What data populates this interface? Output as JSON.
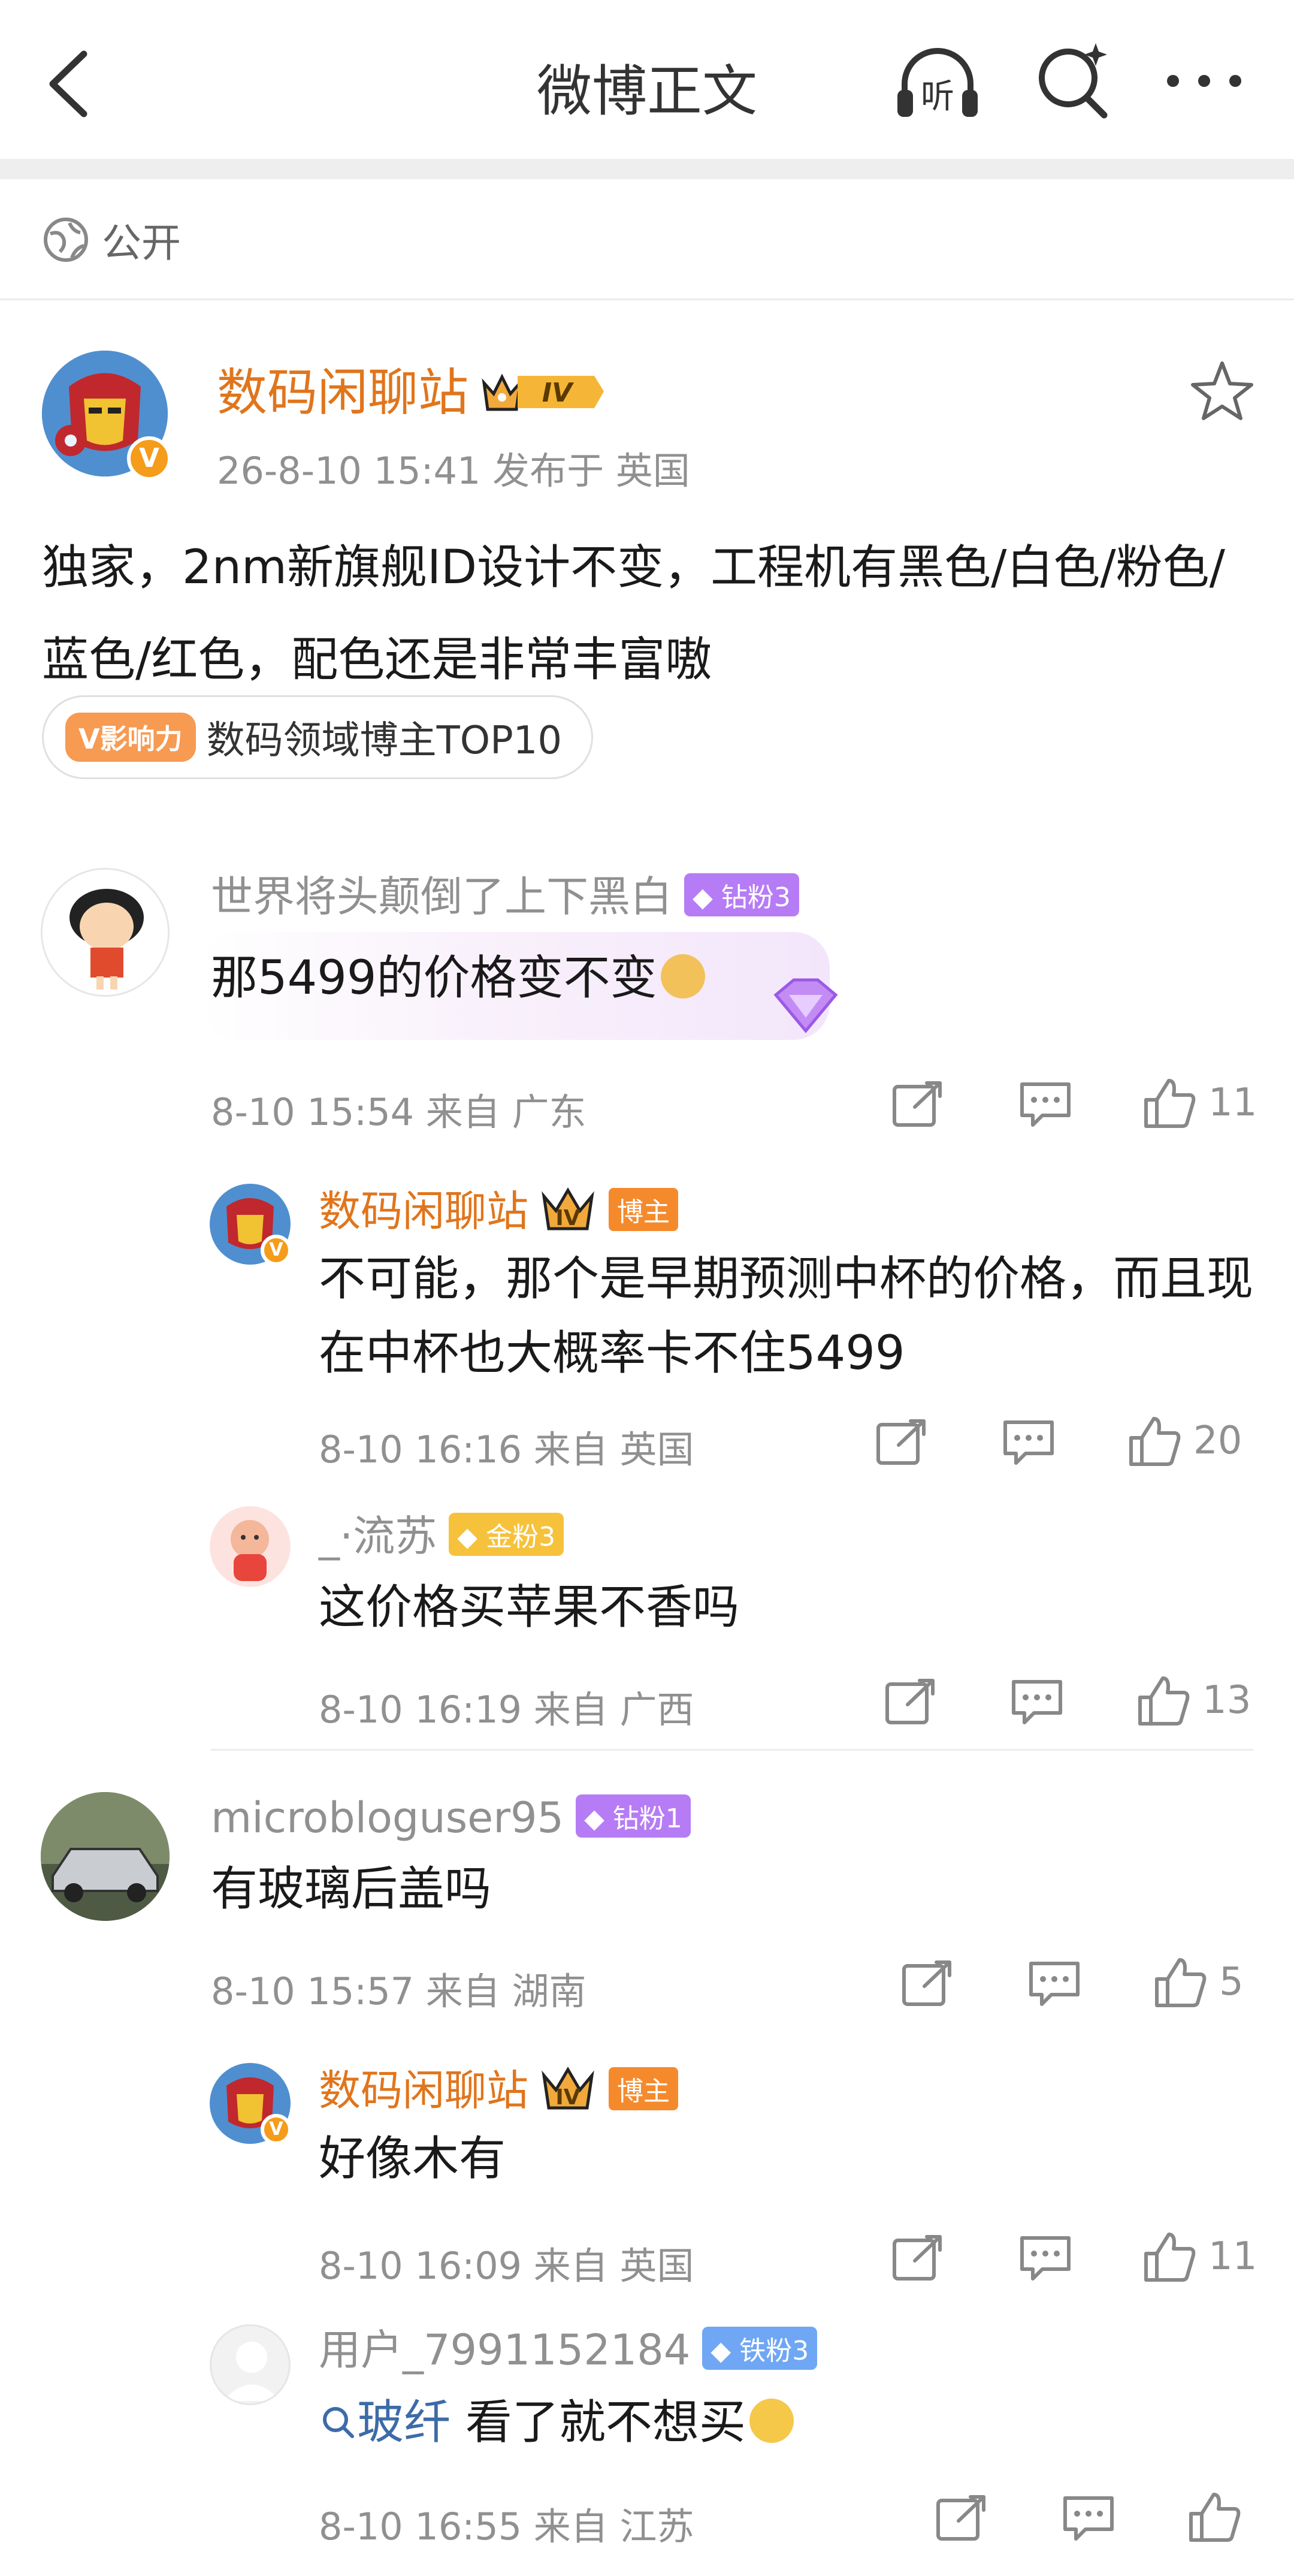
{
  "header": {
    "title": "微博正文",
    "back_icon": "back-arrow-icon",
    "listen_icon": "listen-headphones-icon",
    "listen_label": "听",
    "search_icon": "search-sparkle-icon",
    "more_icon": "more-dots-icon"
  },
  "visibility": {
    "icon": "globe-icon",
    "label": "公开"
  },
  "post": {
    "author": "数码闲聊站",
    "level": "IV",
    "meta": "26-8-10 15:41  发布于 英国",
    "text": "独家，2nm新旗舰ID设计不变，工程机有黑色/白色/粉色/蓝色/红色，配色还是非常丰富嗷",
    "influence_tag": "V影响力",
    "influence_label": "数码领域博主TOP10",
    "favorite_icon": "star-outline-icon"
  },
  "comments": [
    {
      "user": "世界将头颠倒了上下黑白",
      "badge": "钻粉3",
      "text": "那5499的价格变不变",
      "meta": "8-10 15:54  来自 广东",
      "likes": "11",
      "replies": [
        {
          "user": "数码闲聊站",
          "level": "IV",
          "role": "博主",
          "text": "不可能，那个是早期预测中杯的价格，而且现在中杯也大概率卡不住5499",
          "meta": "8-10 16:16  来自 英国",
          "likes": "20"
        },
        {
          "user": "_·流苏",
          "badge": "金粉3",
          "text": "这价格买苹果不香吗",
          "meta": "8-10 16:19  来自 广西",
          "likes": "13"
        }
      ]
    },
    {
      "user": "microbloguser95",
      "badge": "钻粉1",
      "text": "有玻璃后盖吗",
      "meta": "8-10 15:57  来自 湖南",
      "likes": "5",
      "replies": [
        {
          "user": "数码闲聊站",
          "level": "IV",
          "role": "博主",
          "text": "好像木有",
          "meta": "8-10 16:09  来自 英国",
          "likes": "11"
        },
        {
          "user": "用户_7991152184",
          "badge": "铁粉3",
          "search_term": "玻纤",
          "text": "看了就不想买",
          "meta": "8-10 16:55  来自 江苏",
          "likes": ""
        }
      ]
    }
  ],
  "colors": {
    "accent_orange": "#e0751c",
    "meta_gray": "#909090",
    "diamond_badge": "#b67cf5",
    "gold_badge": "#f6c23c",
    "iron_badge": "#6fa7f4",
    "link_blue": "#3d6ba8"
  }
}
